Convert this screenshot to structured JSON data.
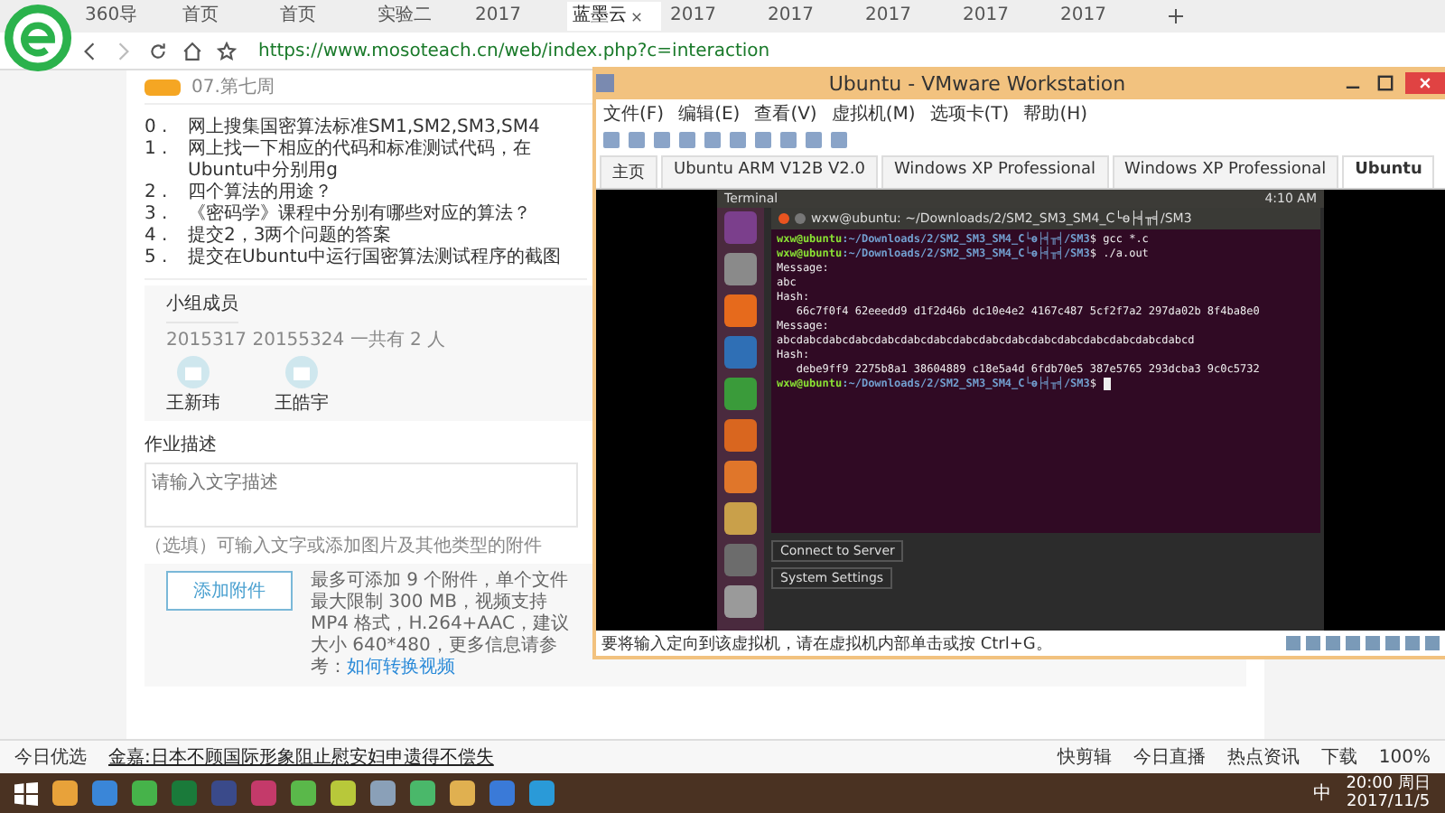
{
  "browser": {
    "tabs": [
      {
        "label": "360导",
        "selected": false
      },
      {
        "label": "首页",
        "selected": false
      },
      {
        "label": "首页",
        "selected": false
      },
      {
        "label": "实验二",
        "selected": false
      },
      {
        "label": "2017",
        "selected": false
      },
      {
        "label": "蓝墨云",
        "selected": true
      },
      {
        "label": "2017",
        "selected": false
      },
      {
        "label": "2017",
        "selected": false
      },
      {
        "label": "2017",
        "selected": false
      },
      {
        "label": "2017",
        "selected": false
      },
      {
        "label": "2017",
        "selected": false
      }
    ],
    "url": "https://www.mosoteach.cn/web/index.php?c=interaction"
  },
  "page": {
    "badge_title": "07.第七周",
    "tasks": [
      {
        "num": "0 .",
        "text": "网上搜集国密算法标准SM1,SM2,SM3,SM4"
      },
      {
        "num": "1 .",
        "text": "网上找一下相应的代码和标准测试代码，在Ubuntu中分别用g"
      },
      {
        "num": "2 .",
        "text": "四个算法的用途？"
      },
      {
        "num": "3 .",
        "text": "《密码学》课程中分别有哪些对应的算法？"
      },
      {
        "num": "4 .",
        "text": "提交2，3两个问题的答案"
      },
      {
        "num": "5 .",
        "text": "提交在Ubuntu中运行国密算法测试程序的截图"
      }
    ],
    "members": {
      "title": "小组成员",
      "summary": "2015317 20155324 一共有 2 人",
      "people": [
        "王新玮",
        "王皓宇"
      ]
    },
    "description": {
      "label": "作业描述",
      "placeholder": "请输入文字描述"
    },
    "optional_note": "（选填）可输入文字或添加图片及其他类型的附件",
    "attach": {
      "button": "添加附件",
      "note": "最多可添加 9 个附件，单个文件最大限制 300 MB，视频支持 MP4 格式，H.264+AAC，建议大小 640*480，更多信息请参考：",
      "link": "如何转换视频"
    }
  },
  "browser_status": {
    "left": "今日优选",
    "news": "金嘉:日本不顾国际形象阻止慰安妇申遗得不偿失",
    "items": [
      "快剪辑",
      "今日直播",
      "热点资讯",
      "下载"
    ],
    "zoom": "100%"
  },
  "taskbar": {
    "ime": "中",
    "time": "20:00 周日",
    "date": "2017/11/5"
  },
  "vmware": {
    "title": "Ubuntu - VMware Workstation",
    "menu": [
      "文件(F)",
      "编辑(E)",
      "查看(V)",
      "虚拟机(M)",
      "选项卡(T)",
      "帮助(H)"
    ],
    "tabs": [
      {
        "label": "主页",
        "selected": false
      },
      {
        "label": "Ubuntu ARM V12B V2.0",
        "selected": false
      },
      {
        "label": "Windows XP Professional",
        "selected": false
      },
      {
        "label": "Windows XP Professional",
        "selected": false
      },
      {
        "label": "Ubuntu",
        "selected": true
      }
    ],
    "status": "要将输入定向到该虚拟机，请在虚拟机内部单击或按 Ctrl+G。",
    "ubuntu": {
      "app": "Terminal",
      "time": "4:10 AM",
      "terminal_title": "wxw@ubuntu: ~/Downloads/2/SM2_SM3_SM4_C└ө├╡╥╡/SM3",
      "lines": [
        {
          "kind": "prompt",
          "user": "wxw@ubuntu",
          "path": ":~/Downloads/2/SM2_SM3_SM4_C└ө├╡╥╡/SM3",
          "cmd": "$ gcc *.c",
          "cursor": false
        },
        {
          "kind": "prompt",
          "user": "wxw@ubuntu",
          "path": ":~/Downloads/2/SM2_SM3_SM4_C└ө├╡╥╡/SM3",
          "cmd": "$ ./a.out",
          "cursor": false
        },
        {
          "kind": "output",
          "text": "Message:"
        },
        {
          "kind": "output",
          "text": "abc"
        },
        {
          "kind": "output",
          "text": "Hash:"
        },
        {
          "kind": "output",
          "text": "   66c7f0f4 62eeedd9 d1f2d46b dc10e4e2 4167c487 5cf2f7a2 297da02b 8f4ba8e0"
        },
        {
          "kind": "output",
          "text": "Message:"
        },
        {
          "kind": "output",
          "text": "abcdabcdabcdabcdabcdabcdabcdabcdabcdabcdabcdabcdabcdabcdabcdabcd"
        },
        {
          "kind": "output",
          "text": "Hash:"
        },
        {
          "kind": "output",
          "text": "   debe9ff9 2275b8a1 38604889 c18e5a4d 6fdb70e5 387e5765 293dcba3 9c0c5732"
        },
        {
          "kind": "prompt",
          "user": "wxw@ubuntu",
          "path": ":~/Downloads/2/SM2_SM3_SM4_C└ө├╡╥╡/SM3",
          "cmd": "$ ",
          "cursor": true
        }
      ],
      "tooltips": [
        "Connect to Server",
        "System Settings"
      ]
    }
  }
}
